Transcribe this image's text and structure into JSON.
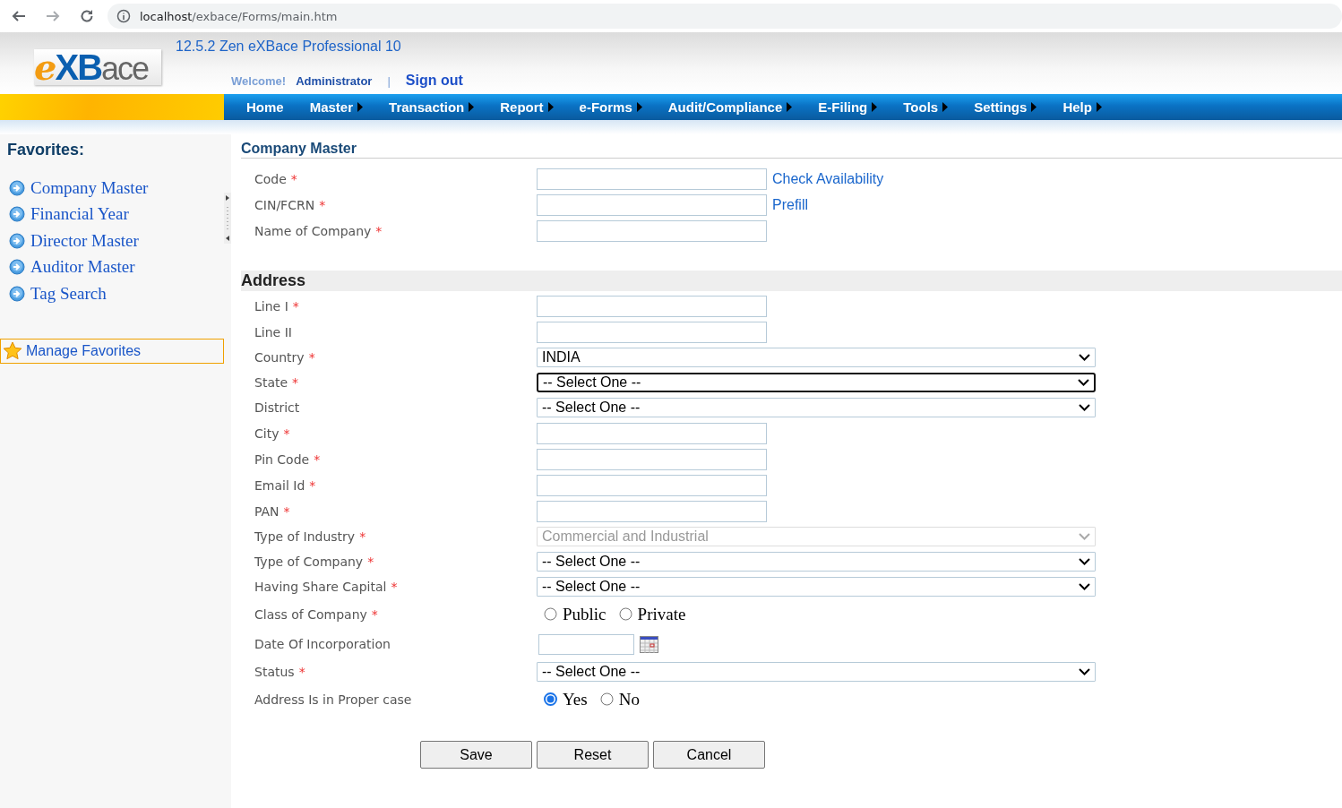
{
  "browser": {
    "host": "localhost",
    "path": "/exbace/Forms/main.htm"
  },
  "header": {
    "logo": [
      "e",
      "XB",
      "ace"
    ],
    "version": "12.5.2 Zen eXBace Professional 10",
    "welcome": "Welcome!",
    "user": "Administrator",
    "separator": "|",
    "sign_out": "Sign out"
  },
  "nav": [
    {
      "label": "Home",
      "submenu": false
    },
    {
      "label": "Master",
      "submenu": true
    },
    {
      "label": "Transaction",
      "submenu": true
    },
    {
      "label": "Report",
      "submenu": true
    },
    {
      "label": "e-Forms",
      "submenu": true
    },
    {
      "label": "Audit/Compliance",
      "submenu": true
    },
    {
      "label": "E-Filing",
      "submenu": true
    },
    {
      "label": "Tools",
      "submenu": true
    },
    {
      "label": "Settings",
      "submenu": true
    },
    {
      "label": "Help",
      "submenu": true
    }
  ],
  "sidebar": {
    "title": "Favorites:",
    "items": [
      "Company Master",
      "Financial Year",
      "Director Master",
      "Auditor Master",
      "Tag Search"
    ],
    "manage": "Manage Favorites"
  },
  "form": {
    "title": "Company Master",
    "required_mark": "*",
    "fields": [
      {
        "kind": "text",
        "label": "Code",
        "required": true,
        "link": "Check Availability"
      },
      {
        "kind": "text",
        "label": "CIN/FCRN",
        "required": true,
        "link": "Prefill"
      },
      {
        "kind": "text",
        "label": "Name of Company",
        "required": true
      }
    ],
    "address": {
      "title": "Address",
      "fields": [
        {
          "kind": "text",
          "label": "Line I",
          "required": true
        },
        {
          "kind": "text",
          "label": "Line II",
          "required": false
        },
        {
          "kind": "select",
          "label": "Country",
          "required": true,
          "value": "INDIA",
          "focused": false,
          "disabled": false
        },
        {
          "kind": "select",
          "label": "State",
          "required": true,
          "value": "-- Select One --",
          "focused": true,
          "disabled": false
        },
        {
          "kind": "select",
          "label": "District",
          "required": false,
          "value": "-- Select One --",
          "focused": false,
          "disabled": false
        },
        {
          "kind": "text",
          "label": "City",
          "required": true
        },
        {
          "kind": "text",
          "label": "Pin Code",
          "required": true
        },
        {
          "kind": "text",
          "label": "Email Id",
          "required": true
        },
        {
          "kind": "text",
          "label": "PAN",
          "required": true
        },
        {
          "kind": "select",
          "label": "Type of Industry",
          "required": true,
          "value": "Commercial and Industrial",
          "focused": false,
          "disabled": true
        },
        {
          "kind": "select",
          "label": "Type of Company",
          "required": true,
          "value": "-- Select One --",
          "focused": false,
          "disabled": false
        },
        {
          "kind": "select",
          "label": "Having Share Capital",
          "required": true,
          "value": "-- Select One --",
          "focused": false,
          "disabled": false
        },
        {
          "kind": "radio",
          "label": "Class of Company",
          "required": true,
          "options": [
            {
              "label": "Public",
              "selected": false
            },
            {
              "label": "Private",
              "selected": false
            }
          ]
        },
        {
          "kind": "date",
          "label": "Date Of Incorporation",
          "required": false
        },
        {
          "kind": "select",
          "label": "Status",
          "required": true,
          "value": "-- Select One --",
          "focused": false,
          "disabled": false
        },
        {
          "kind": "radio",
          "label": "Address Is in Proper case",
          "required": false,
          "options": [
            {
              "label": "Yes",
              "selected": true
            },
            {
              "label": "No",
              "selected": false
            }
          ]
        }
      ]
    },
    "buttons": [
      "Save",
      "Reset",
      "Cancel"
    ]
  }
}
